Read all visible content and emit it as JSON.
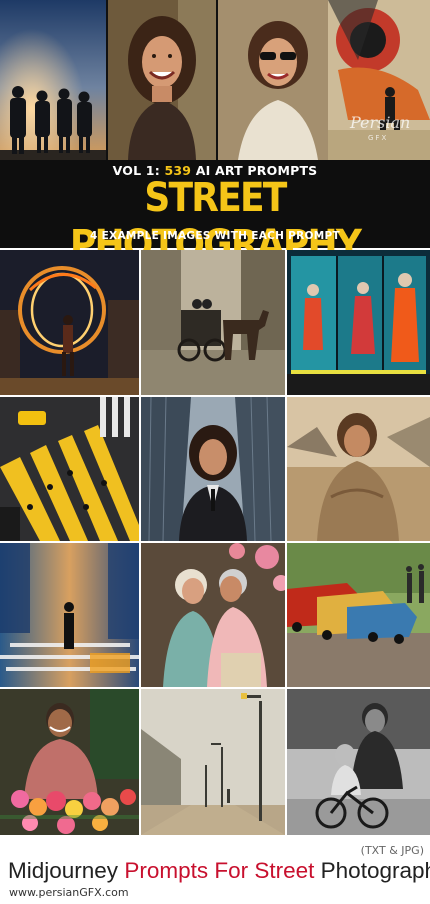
{
  "banner": {
    "vol_prefix": "VOL 1:",
    "prompt_count": "539",
    "vol_suffix": "AI ART PROMPTS",
    "headline": "STREET PHOTOGRAPHY",
    "subline": "4 EXAMPLE IMAGES WITH EACH PROMPT"
  },
  "top_images": [
    "silhouettes-in-fog-photo",
    "smiling-woman-portrait-photo",
    "woman-with-sunglasses-collage-photo"
  ],
  "grid_images": [
    "fire-dancer-photo",
    "horse-carriage-street-photo",
    "shop-window-mannequins-photo",
    "crosswalk-aerial-photo",
    "woman-in-suit-skyscrapers-photo",
    "child-in-desert-photo",
    "motion-blur-city-photo",
    "elderly-couple-dancing-photo",
    "vintage-cars-street-photo",
    "flower-vendor-photo",
    "foggy-street-lamps-photo",
    "father-child-bicycle-photo"
  ],
  "watermark": {
    "text": "Persian",
    "sub": "GFX"
  },
  "footer": {
    "formats": "(TXT & JPG)",
    "title_part1": "Midjourney",
    "title_part2": "Prompts For Street",
    "title_part3": "Photography",
    "website": "www.persianGFX.com"
  },
  "colors": {
    "accent": "#f5c518",
    "brand_red": "#c8102e",
    "banner_bg": "#0e0e0e"
  }
}
